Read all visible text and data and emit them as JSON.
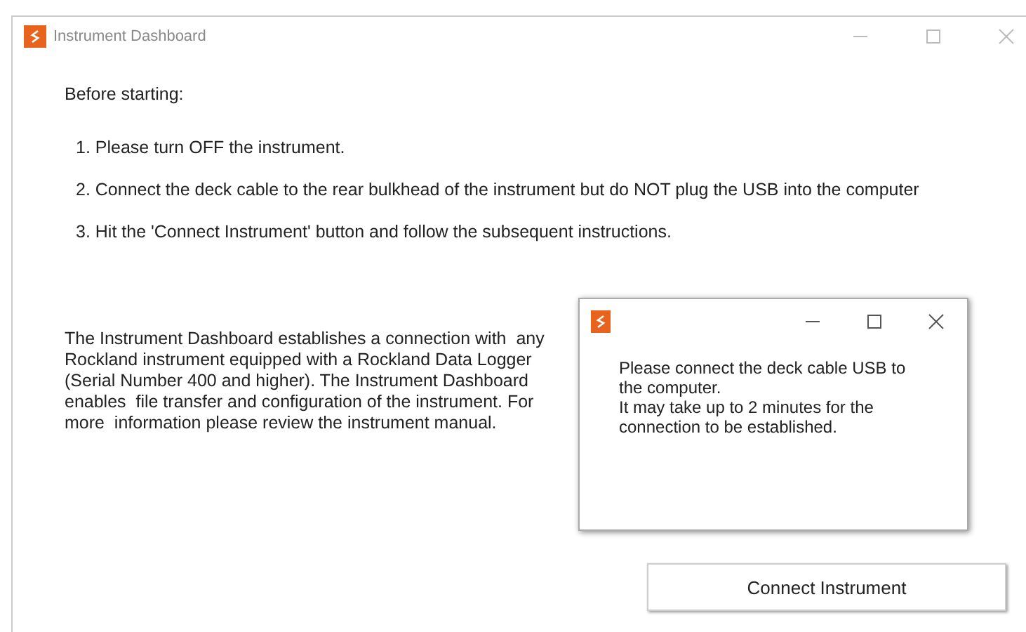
{
  "window": {
    "title": "Instrument Dashboard"
  },
  "heading": "Before starting:",
  "steps": [
    "1. Please turn OFF the instrument.",
    "2. Connect the deck cable to the rear bulkhead of the instrument but do NOT plug the USB into the computer",
    "3. Hit the 'Connect Instrument' button and follow the subsequent instructions."
  ],
  "description": "The Instrument Dashboard establishes a connection with  any\nRockland instrument equipped with a Rockland Data Logger\n(Serial Number 400 and higher). The Instrument Dashboard\nenables  file transfer and configuration of the instrument. For\nmore  information please review the instrument manual.",
  "dialog": {
    "message": "Please connect the deck cable USB to\nthe computer.\nIt may take up to 2 minutes for the\nconnection to be established."
  },
  "buttons": [
    "Connect Instrument"
  ]
}
